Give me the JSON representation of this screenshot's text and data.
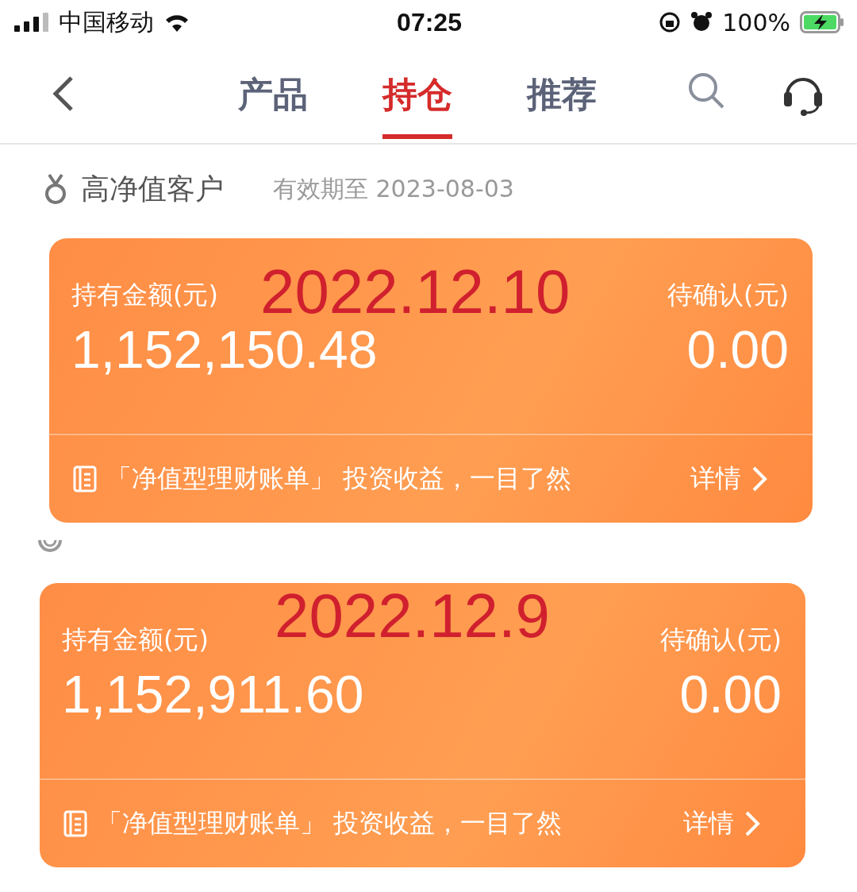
{
  "status_bar": {
    "carrier": "中国移动",
    "time": "07:25",
    "battery": "100%"
  },
  "tabs": [
    {
      "label": "产品",
      "selected": false
    },
    {
      "label": "持仓",
      "selected": true
    },
    {
      "label": "推荐",
      "selected": false
    }
  ],
  "member": {
    "label": "高净值客户",
    "expiry": "有效期至 2023-08-03"
  },
  "cards": [
    {
      "annotation": "2022.12.10",
      "holding_label": "持有金额(元)",
      "holding_value": "1,152,150.48",
      "pending_label": "待确认(元)",
      "pending_value": "0.00",
      "bill_text": "「净值型理财账单」 投资收益，一目了然",
      "details": "详情"
    },
    {
      "annotation": "2022.12.9",
      "holding_label": "持有金额(元)",
      "holding_value": "1,152,911.60",
      "pending_label": "待确认(元)",
      "pending_value": "0.00",
      "bill_text": "「净值型理财账单」 投资收益，一目了然",
      "details": "详情"
    }
  ]
}
